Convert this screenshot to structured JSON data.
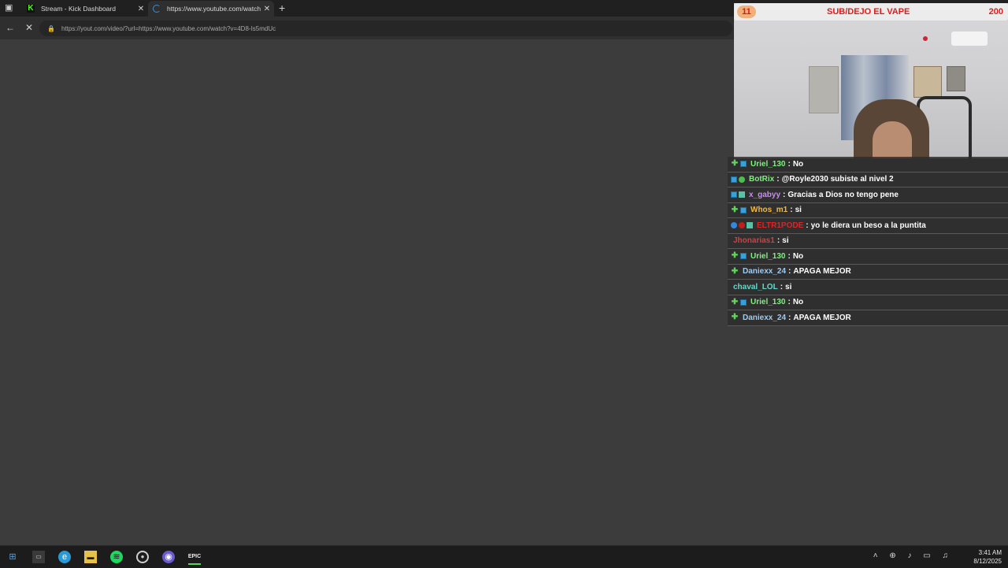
{
  "browser": {
    "tabs": [
      {
        "title": "Stream - Kick Dashboard",
        "favicon": "kick-icon",
        "active": false
      },
      {
        "title": "https://www.youtube.com/watch",
        "favicon": "loading-spinner-icon",
        "active": true
      }
    ],
    "new_tab_label": "+",
    "address_url": "https://yout.com/video/?url=https://www.youtube.com/watch?v=4D8-Is5mdUc"
  },
  "stream_overlay": {
    "goal_current": "11",
    "goal_label": "SUB/DEJO EL VAPE",
    "goal_target": "200"
  },
  "chat": [
    {
      "user": "Uriel_130",
      "text": "No",
      "color": "#7cf27c",
      "badges": [
        "plus",
        "blue"
      ]
    },
    {
      "user": "BotRix",
      "text": "@Royle2030 subiste al nivel 2",
      "color": "#7cf27c",
      "badges": [
        "blue",
        "green"
      ]
    },
    {
      "user": "x_gabyy",
      "text": "Gracias a Dios no tengo pene",
      "color": "#c88cf0",
      "badges": [
        "blue",
        "cyan"
      ]
    },
    {
      "user": "Whos_m1",
      "text": "si",
      "color": "#f0b84a",
      "badges": [
        "plus",
        "blue"
      ]
    },
    {
      "user": "ELTR1PODE",
      "text": "yo le diera un beso a la puntita",
      "color": "#e02424",
      "badges": [
        "globe",
        "red",
        "cyan"
      ]
    },
    {
      "user": "Jhonarias1",
      "text": "si",
      "color": "#e03a3a",
      "badges": []
    },
    {
      "user": "Uriel_130",
      "text": "No",
      "color": "#7cf27c",
      "badges": [
        "plus",
        "blue"
      ]
    },
    {
      "user": "Daniexx_24",
      "text": "APAGA MEJOR",
      "color": "#9ecbf0",
      "badges": [
        "plus"
      ]
    },
    {
      "user": "chaval_LOL",
      "text": "si",
      "color": "#68d6c9",
      "badges": []
    },
    {
      "user": "Uriel_130",
      "text": "No",
      "color": "#7cf27c",
      "badges": [
        "plus",
        "blue"
      ]
    },
    {
      "user": "Daniexx_24",
      "text": "APAGA MEJOR",
      "color": "#9ecbf0",
      "badges": [
        "plus"
      ]
    }
  ],
  "taskbar": {
    "apps": [
      "windows-start-icon",
      "terminal-icon",
      "edge-icon",
      "file-explorer-icon",
      "spotify-icon",
      "obs-icon",
      "browser-icon",
      "epic-games-icon"
    ],
    "time": "3:41 AM",
    "date": "8/12/2025"
  }
}
